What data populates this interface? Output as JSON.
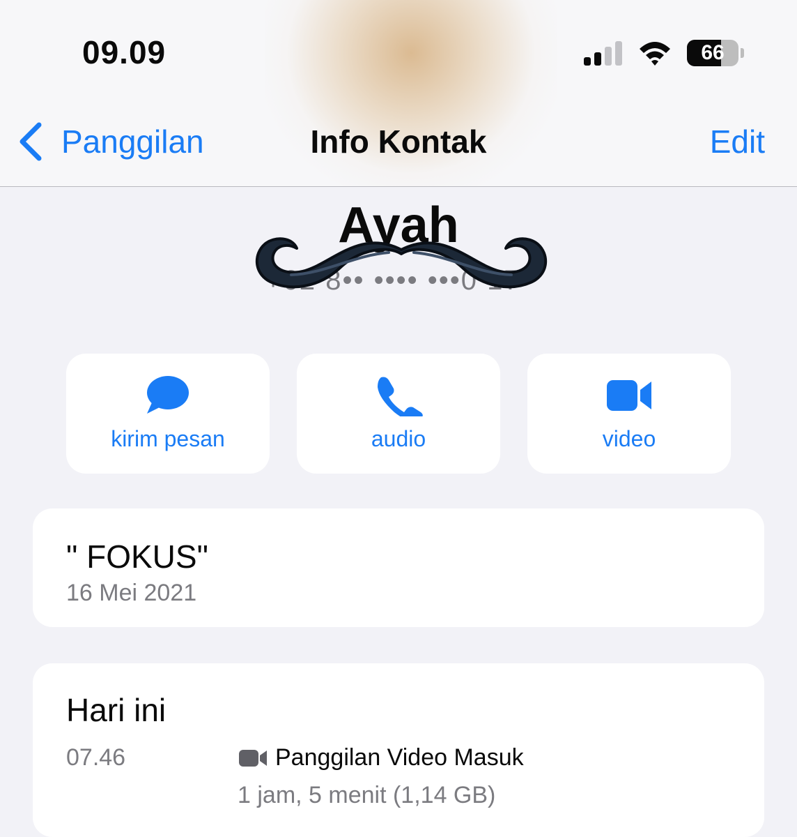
{
  "status_bar": {
    "time": "09.09",
    "battery_percent": "66",
    "battery_level": 0.66,
    "signal_bars_active": 2,
    "signal_bars_total": 4
  },
  "nav": {
    "back_label": "Panggilan",
    "title": "Info Kontak",
    "edit_label": "Edit"
  },
  "contact": {
    "name": "Ayah",
    "number": "+62 8•• •••• •••0 17•"
  },
  "actions": [
    {
      "label": "kirim pesan",
      "icon": "message-bubble-icon"
    },
    {
      "label": "audio",
      "icon": "phone-icon"
    },
    {
      "label": "video",
      "icon": "video-camera-icon"
    }
  ],
  "about": {
    "status": "\" FOKUS\"",
    "date": "16 Mei 2021"
  },
  "calls": {
    "heading": "Hari ini",
    "items": [
      {
        "time": "07.46",
        "type": "Panggilan Video Masuk",
        "detail": "1 jam, 5 menit (1,14 GB)",
        "icon": "video-camera-icon"
      }
    ]
  },
  "colors": {
    "accent": "#1a7cf5",
    "background": "#f2f2f7",
    "secondary_text": "#7b7b80"
  }
}
